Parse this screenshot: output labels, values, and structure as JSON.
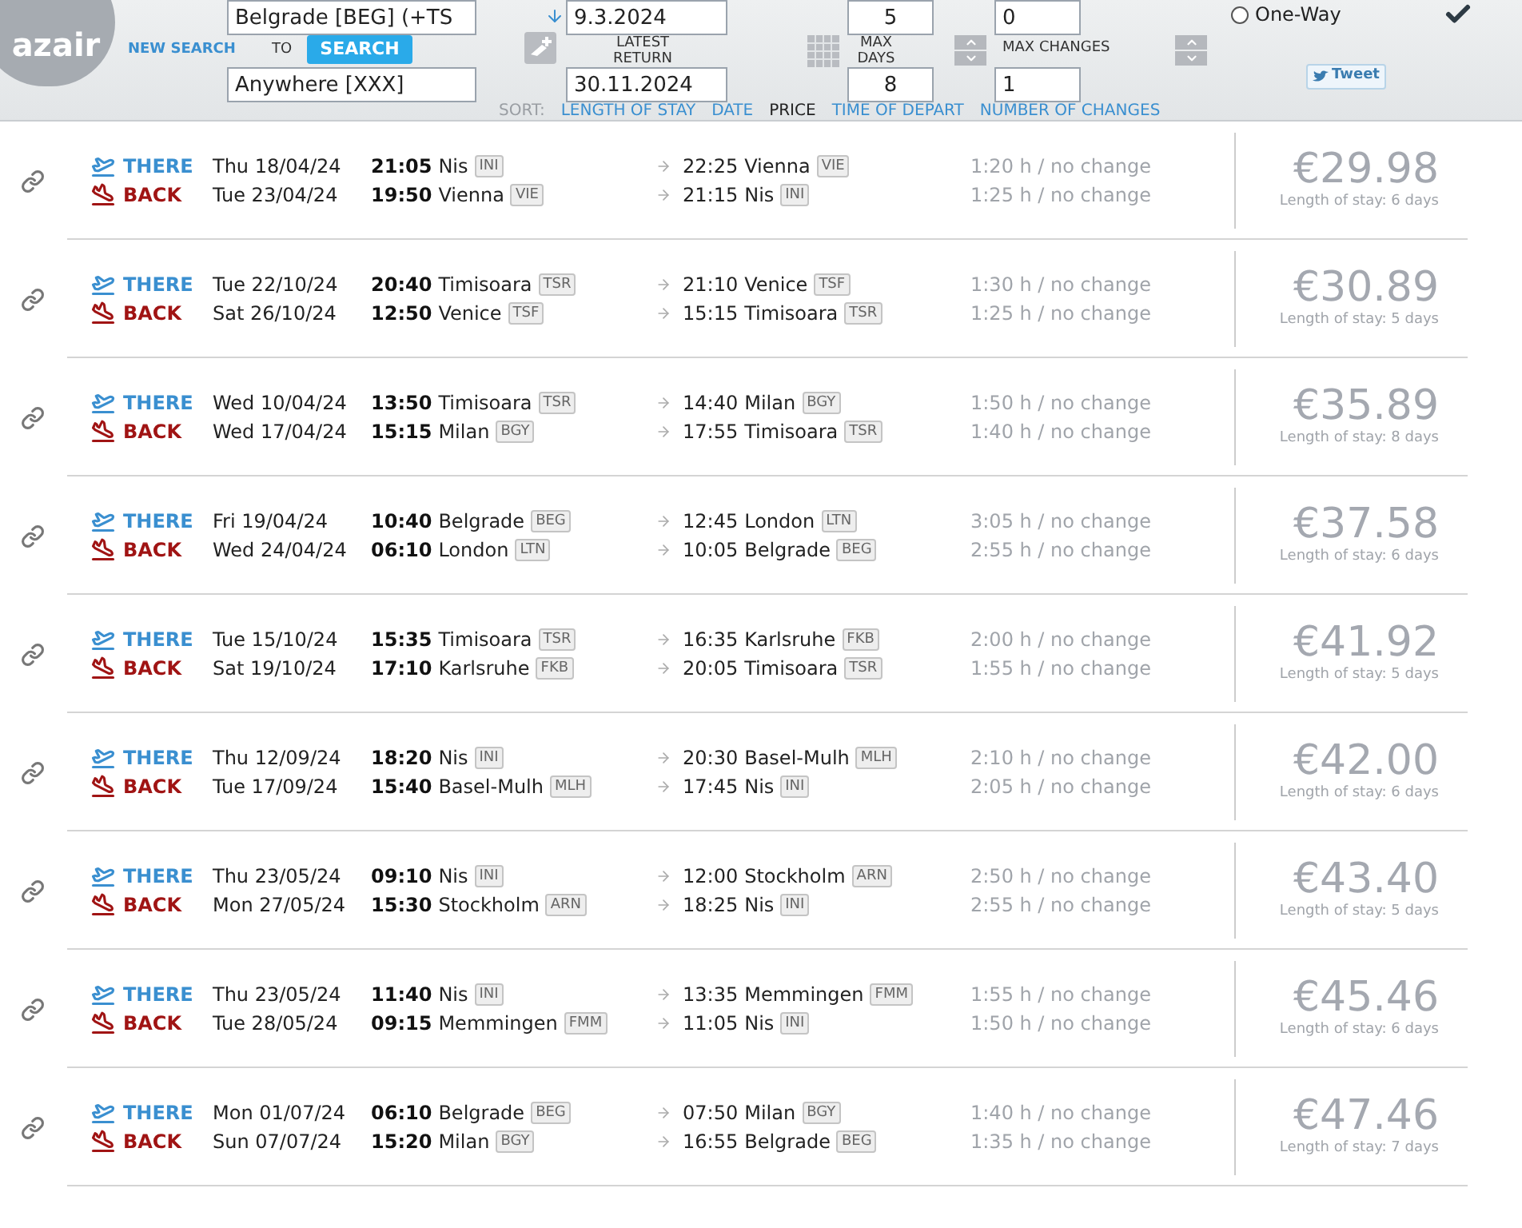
{
  "logo": "azair",
  "search": {
    "from": "Belgrade [BEG] (+TS",
    "to_label": "TO",
    "to": "Anywhere [XXX]",
    "new_search": "NEW SEARCH",
    "search_button": "SEARCH",
    "depart_date": "9.3.2024",
    "return_label": "LATEST RETURN",
    "return_date": "30.11.2024",
    "min_days": "5",
    "max_days_label": "MAX DAYS",
    "max_days": "8",
    "min_changes": "0",
    "max_changes_label": "MAX CHANGES",
    "max_changes": "1",
    "one_way": {
      "label": "One-Way",
      "checked": false
    },
    "tweet": "Tweet"
  },
  "sort": {
    "label": "SORT:",
    "options": [
      {
        "label": "LENGTH OF STAY",
        "selected": false
      },
      {
        "label": "DATE",
        "selected": false
      },
      {
        "label": "PRICE",
        "selected": true
      },
      {
        "label": "TIME OF DEPART",
        "selected": false
      },
      {
        "label": "NUMBER OF CHANGES",
        "selected": false
      }
    ]
  },
  "results": [
    {
      "legs": [
        {
          "kind": "there",
          "label": "THERE",
          "date": "Thu 18/04/24",
          "dep_time": "21:05",
          "dep_city": "Nis",
          "dep_code": "INI",
          "arr_time": "22:25",
          "arr_city": "Vienna",
          "arr_code": "VIE",
          "duration": "1:20 h / no change"
        },
        {
          "kind": "back",
          "label": "BACK",
          "date": "Tue 23/04/24",
          "dep_time": "19:50",
          "dep_city": "Vienna",
          "dep_code": "VIE",
          "arr_time": "21:15",
          "arr_city": "Nis",
          "arr_code": "INI",
          "duration": "1:25 h / no change"
        }
      ],
      "price": "€29.98",
      "stay": "Length of stay: 6 days"
    },
    {
      "legs": [
        {
          "kind": "there",
          "label": "THERE",
          "date": "Tue 22/10/24",
          "dep_time": "20:40",
          "dep_city": "Timisoara",
          "dep_code": "TSR",
          "arr_time": "21:10",
          "arr_city": "Venice",
          "arr_code": "TSF",
          "duration": "1:30 h / no change"
        },
        {
          "kind": "back",
          "label": "BACK",
          "date": "Sat 26/10/24",
          "dep_time": "12:50",
          "dep_city": "Venice",
          "dep_code": "TSF",
          "arr_time": "15:15",
          "arr_city": "Timisoara",
          "arr_code": "TSR",
          "duration": "1:25 h / no change"
        }
      ],
      "price": "€30.89",
      "stay": "Length of stay: 5 days"
    },
    {
      "legs": [
        {
          "kind": "there",
          "label": "THERE",
          "date": "Wed 10/04/24",
          "dep_time": "13:50",
          "dep_city": "Timisoara",
          "dep_code": "TSR",
          "arr_time": "14:40",
          "arr_city": "Milan",
          "arr_code": "BGY",
          "duration": "1:50 h / no change"
        },
        {
          "kind": "back",
          "label": "BACK",
          "date": "Wed 17/04/24",
          "dep_time": "15:15",
          "dep_city": "Milan",
          "dep_code": "BGY",
          "arr_time": "17:55",
          "arr_city": "Timisoara",
          "arr_code": "TSR",
          "duration": "1:40 h / no change"
        }
      ],
      "price": "€35.89",
      "stay": "Length of stay: 8 days"
    },
    {
      "legs": [
        {
          "kind": "there",
          "label": "THERE",
          "date": "Fri 19/04/24",
          "dep_time": "10:40",
          "dep_city": "Belgrade",
          "dep_code": "BEG",
          "arr_time": "12:45",
          "arr_city": "London",
          "arr_code": "LTN",
          "duration": "3:05 h / no change"
        },
        {
          "kind": "back",
          "label": "BACK",
          "date": "Wed 24/04/24",
          "dep_time": "06:10",
          "dep_city": "London",
          "dep_code": "LTN",
          "arr_time": "10:05",
          "arr_city": "Belgrade",
          "arr_code": "BEG",
          "duration": "2:55 h / no change"
        }
      ],
      "price": "€37.58",
      "stay": "Length of stay: 6 days"
    },
    {
      "legs": [
        {
          "kind": "there",
          "label": "THERE",
          "date": "Tue 15/10/24",
          "dep_time": "15:35",
          "dep_city": "Timisoara",
          "dep_code": "TSR",
          "arr_time": "16:35",
          "arr_city": "Karlsruhe",
          "arr_code": "FKB",
          "duration": "2:00 h / no change"
        },
        {
          "kind": "back",
          "label": "BACK",
          "date": "Sat 19/10/24",
          "dep_time": "17:10",
          "dep_city": "Karlsruhe",
          "dep_code": "FKB",
          "arr_time": "20:05",
          "arr_city": "Timisoara",
          "arr_code": "TSR",
          "duration": "1:55 h / no change"
        }
      ],
      "price": "€41.92",
      "stay": "Length of stay: 5 days"
    },
    {
      "legs": [
        {
          "kind": "there",
          "label": "THERE",
          "date": "Thu 12/09/24",
          "dep_time": "18:20",
          "dep_city": "Nis",
          "dep_code": "INI",
          "arr_time": "20:30",
          "arr_city": "Basel-Mulh",
          "arr_code": "MLH",
          "duration": "2:10 h / no change"
        },
        {
          "kind": "back",
          "label": "BACK",
          "date": "Tue 17/09/24",
          "dep_time": "15:40",
          "dep_city": "Basel-Mulh",
          "dep_code": "MLH",
          "arr_time": "17:45",
          "arr_city": "Nis",
          "arr_code": "INI",
          "duration": "2:05 h / no change"
        }
      ],
      "price": "€42.00",
      "stay": "Length of stay: 6 days"
    },
    {
      "legs": [
        {
          "kind": "there",
          "label": "THERE",
          "date": "Thu 23/05/24",
          "dep_time": "09:10",
          "dep_city": "Nis",
          "dep_code": "INI",
          "arr_time": "12:00",
          "arr_city": "Stockholm",
          "arr_code": "ARN",
          "duration": "2:50 h / no change"
        },
        {
          "kind": "back",
          "label": "BACK",
          "date": "Mon 27/05/24",
          "dep_time": "15:30",
          "dep_city": "Stockholm",
          "dep_code": "ARN",
          "arr_time": "18:25",
          "arr_city": "Nis",
          "arr_code": "INI",
          "duration": "2:55 h / no change"
        }
      ],
      "price": "€43.40",
      "stay": "Length of stay: 5 days"
    },
    {
      "legs": [
        {
          "kind": "there",
          "label": "THERE",
          "date": "Thu 23/05/24",
          "dep_time": "11:40",
          "dep_city": "Nis",
          "dep_code": "INI",
          "arr_time": "13:35",
          "arr_city": "Memmingen",
          "arr_code": "FMM",
          "duration": "1:55 h / no change"
        },
        {
          "kind": "back",
          "label": "BACK",
          "date": "Tue 28/05/24",
          "dep_time": "09:15",
          "dep_city": "Memmingen",
          "dep_code": "FMM",
          "arr_time": "11:05",
          "arr_city": "Nis",
          "arr_code": "INI",
          "duration": "1:50 h / no change"
        }
      ],
      "price": "€45.46",
      "stay": "Length of stay: 6 days"
    },
    {
      "legs": [
        {
          "kind": "there",
          "label": "THERE",
          "date": "Mon 01/07/24",
          "dep_time": "06:10",
          "dep_city": "Belgrade",
          "dep_code": "BEG",
          "arr_time": "07:50",
          "arr_city": "Milan",
          "arr_code": "BGY",
          "duration": "1:40 h / no change"
        },
        {
          "kind": "back",
          "label": "BACK",
          "date": "Sun 07/07/24",
          "dep_time": "15:20",
          "dep_city": "Milan",
          "dep_code": "BGY",
          "arr_time": "16:55",
          "arr_city": "Belgrade",
          "arr_code": "BEG",
          "duration": "1:35 h / no change"
        }
      ],
      "price": "€47.46",
      "stay": "Length of stay: 7 days"
    }
  ]
}
